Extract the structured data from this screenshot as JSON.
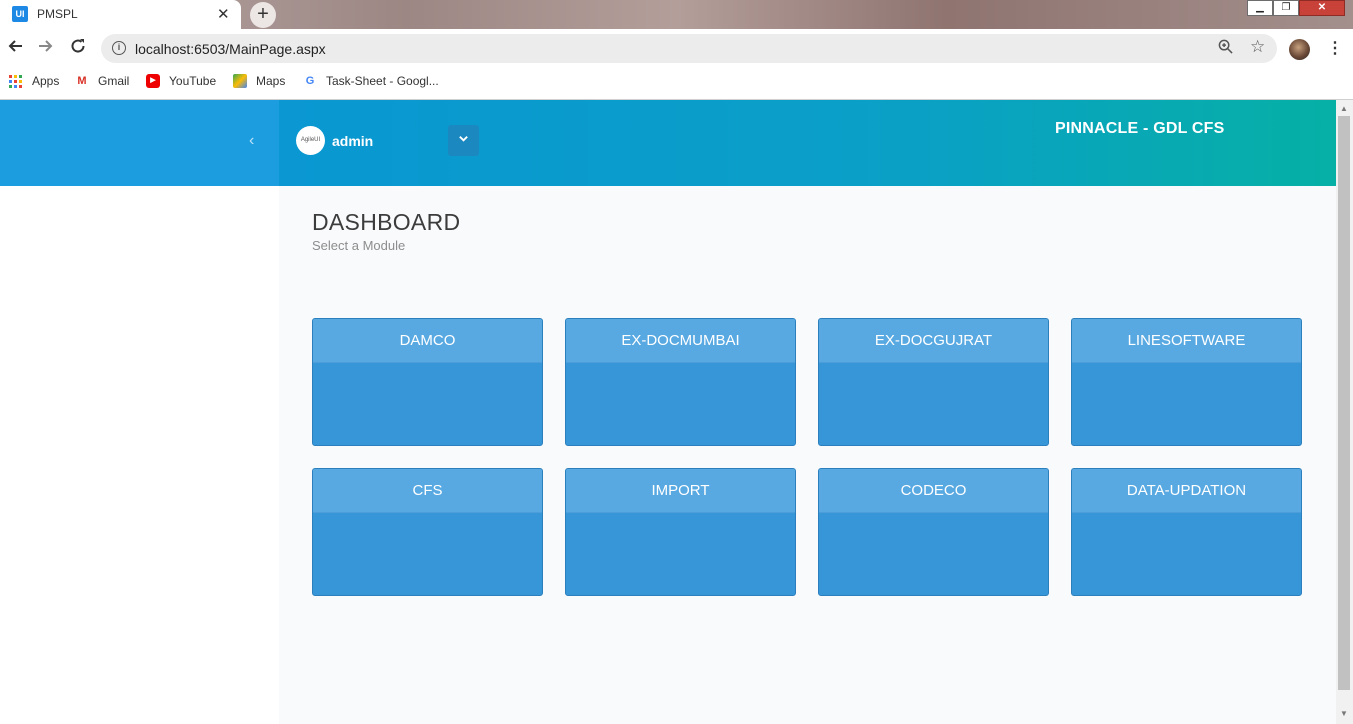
{
  "browser": {
    "tab_title": "PMSPL",
    "favicon_text": "UI",
    "close_glyph": "✕",
    "newtab_glyph": "+",
    "window_controls": {
      "minimize": "▁",
      "maximize": "❐",
      "close": "✕"
    },
    "url": "localhost:6503/MainPage.aspx",
    "bookmarks": [
      {
        "label": "Apps",
        "icon": "apps-grid-icon"
      },
      {
        "label": "Gmail",
        "icon": "gmail-icon"
      },
      {
        "label": "YouTube",
        "icon": "youtube-icon"
      },
      {
        "label": "Maps",
        "icon": "maps-icon"
      },
      {
        "label": "Task-Sheet - Googl...",
        "icon": "google-icon"
      }
    ]
  },
  "header": {
    "user_name": "admin",
    "avatar_text": "AgileUI",
    "brand": "PINNACLE - GDL CFS"
  },
  "dashboard": {
    "title": "DASHBOARD",
    "subtitle": "Select a Module",
    "modules": [
      "DAMCO",
      "EX-DOCMUMBAI",
      "EX-DOCGUJRAT",
      "LINESOFTWARE",
      "CFS",
      "IMPORT",
      "CODECO",
      "DATA-UPDATION"
    ]
  },
  "colors": {
    "header_start": "#0a97d2",
    "header_end": "#06b0a5",
    "card_body": "#3796d8",
    "card_head": "#58a9e2",
    "content_bg": "#f9fafc"
  }
}
